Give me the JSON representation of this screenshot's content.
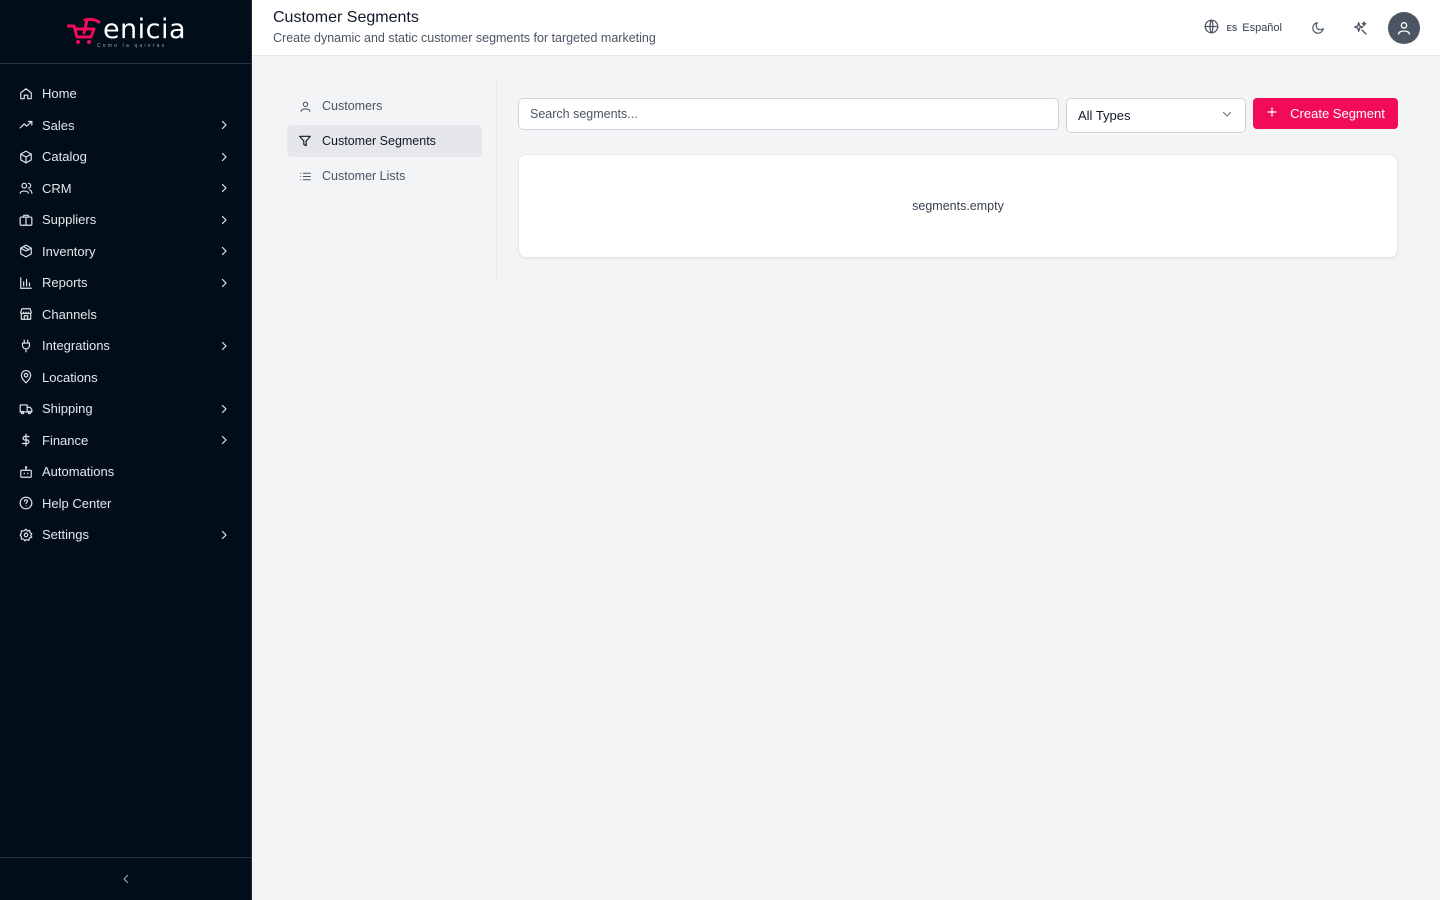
{
  "brand": {
    "name": "enicia",
    "tagline": "Como la quieras",
    "accent_color": "#f20a5b"
  },
  "sidebar": {
    "items": [
      {
        "label": "Home",
        "icon": "home-icon",
        "has_submenu": false
      },
      {
        "label": "Sales",
        "icon": "trending-up-icon",
        "has_submenu": true
      },
      {
        "label": "Catalog",
        "icon": "box-icon",
        "has_submenu": true
      },
      {
        "label": "CRM",
        "icon": "users-icon",
        "has_submenu": true
      },
      {
        "label": "Suppliers",
        "icon": "briefcase-icon",
        "has_submenu": true
      },
      {
        "label": "Inventory",
        "icon": "package-icon",
        "has_submenu": true
      },
      {
        "label": "Reports",
        "icon": "bar-chart-icon",
        "has_submenu": true
      },
      {
        "label": "Channels",
        "icon": "store-icon",
        "has_submenu": false
      },
      {
        "label": "Integrations",
        "icon": "plug-icon",
        "has_submenu": true
      },
      {
        "label": "Locations",
        "icon": "map-pin-icon",
        "has_submenu": false
      },
      {
        "label": "Shipping",
        "icon": "truck-icon",
        "has_submenu": true
      },
      {
        "label": "Finance",
        "icon": "dollar-icon",
        "has_submenu": true
      },
      {
        "label": "Automations",
        "icon": "bot-icon",
        "has_submenu": false
      },
      {
        "label": "Help Center",
        "icon": "help-circle-icon",
        "has_submenu": false
      },
      {
        "label": "Settings",
        "icon": "gear-icon",
        "has_submenu": true
      }
    ]
  },
  "header": {
    "title": "Customer Segments",
    "subtitle": "Create dynamic and static customer segments for targeted marketing",
    "language_code": "ES",
    "language_label": "Español"
  },
  "subnav": {
    "items": [
      {
        "label": "Customers",
        "icon": "user-icon",
        "active": false
      },
      {
        "label": "Customer Segments",
        "icon": "filter-icon",
        "active": true
      },
      {
        "label": "Customer Lists",
        "icon": "list-icon",
        "active": false
      }
    ]
  },
  "toolbar": {
    "search_placeholder": "Search segments...",
    "type_filter_value": "All Types",
    "create_label": "Create Segment"
  },
  "content": {
    "empty_message": "segments.empty"
  }
}
